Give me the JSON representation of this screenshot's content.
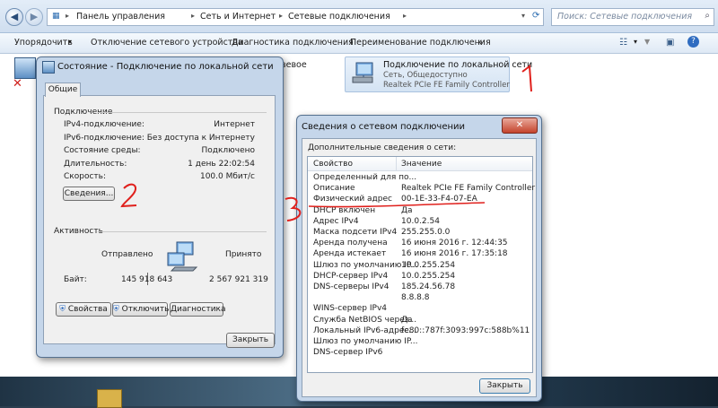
{
  "address_bar": {
    "crumbs": [
      "Панель управления",
      "Сеть и Интернет",
      "Сетевые подключения"
    ],
    "search_placeholder": "Поиск: Сетевые подключения"
  },
  "toolbar": {
    "items": [
      "Упорядочить",
      "Отключение сетевого устройства",
      "Диагностика подключения",
      "Переименование подключения"
    ],
    "more": "»"
  },
  "connection_item": {
    "name": "Подключение по локальной сети",
    "status": "Сеть, Общедоступно",
    "adapter": "Realtek PCIe FE Family Controller",
    "partial_left_text": "вевое"
  },
  "status_dialog": {
    "title": "Состояние - Подключение по локальной сети",
    "tab": "Общие",
    "connection_section": "Подключение",
    "rows": [
      {
        "label": "IPv4-подключение:",
        "value": "Интернет"
      },
      {
        "label": "IPv6-подключение:",
        "value": "Без доступа к Интернету"
      },
      {
        "label": "Состояние среды:",
        "value": "Подключено"
      },
      {
        "label": "Длительность:",
        "value": "1 день 22:02:54"
      },
      {
        "label": "Скорость:",
        "value": "100.0 Мбит/с"
      }
    ],
    "details_button": "Сведения...",
    "activity_section": "Активность",
    "sent_label": "Отправлено",
    "received_label": "Принято",
    "bytes_label": "Байт:",
    "bytes_sent": "145 918 643",
    "bytes_received": "2 567 921 319",
    "properties_button": "Свойства",
    "disable_button": "Отключить",
    "diagnose_button": "Диагностика",
    "close_button": "Закрыть"
  },
  "details_dialog": {
    "title": "Сведения о сетевом подключении",
    "subtitle": "Дополнительные сведения о сети:",
    "col_property": "Свойство",
    "col_value": "Значение",
    "rows": [
      {
        "p": "Определенный для по...",
        "v": ""
      },
      {
        "p": "Описание",
        "v": "Realtek PCIe FE Family Controller"
      },
      {
        "p": "Физический адрес",
        "v": "00-1E-33-F4-07-EA"
      },
      {
        "p": "DHCP включен",
        "v": "Да"
      },
      {
        "p": "Адрес IPv4",
        "v": "10.0.2.54"
      },
      {
        "p": "Маска подсети IPv4",
        "v": "255.255.0.0"
      },
      {
        "p": "Аренда получена",
        "v": "16 июня 2016 г. 12:44:35"
      },
      {
        "p": "Аренда истекает",
        "v": "16 июня 2016 г. 17:35:18"
      },
      {
        "p": "Шлюз по умолчанию IP...",
        "v": "10.0.255.254"
      },
      {
        "p": "DHCP-сервер IPv4",
        "v": "10.0.255.254"
      },
      {
        "p": "DNS-серверы IPv4",
        "v": "185.24.56.78"
      },
      {
        "p": "",
        "v": "8.8.8.8"
      },
      {
        "p": "WINS-сервер IPv4",
        "v": ""
      },
      {
        "p": "Служба NetBIOS через...",
        "v": "Да"
      },
      {
        "p": "Локальный IPv6-адрес...",
        "v": "fe80::787f:3093:997c:588b%11"
      },
      {
        "p": "Шлюз по умолчанию IP...",
        "v": ""
      },
      {
        "p": "DNS-сервер IPv6",
        "v": ""
      }
    ],
    "close_button": "Закрыть"
  },
  "annotations": {
    "one": "1",
    "two": "2",
    "three": "3"
  },
  "colors": {
    "annotation": "#e0201c",
    "titlebar": "#c5d6ea"
  }
}
